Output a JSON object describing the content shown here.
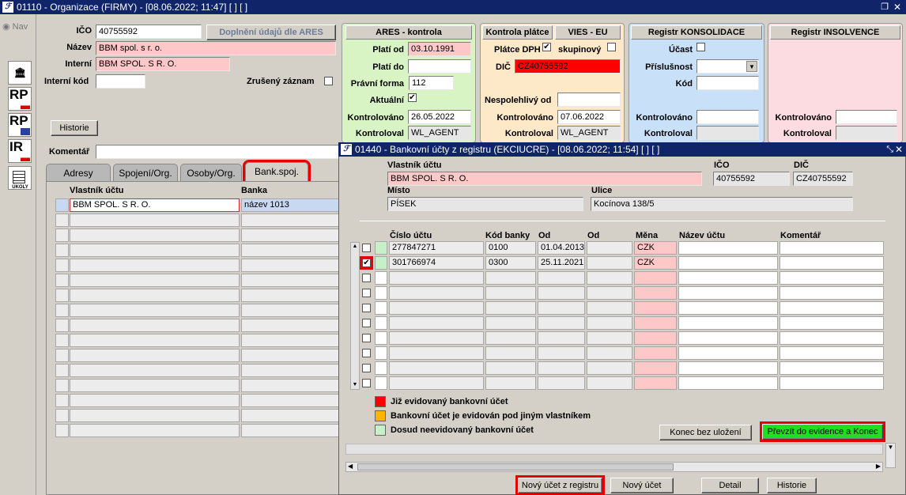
{
  "window": {
    "title": "01110 - Organizace (FIRMY) - [08.06.2022; 11:47]  [ ]  [ ]",
    "icon": "oracle-forms-icon"
  },
  "nav": {
    "label": "Nav"
  },
  "side": {
    "rp1": "RP",
    "rp2": "RP",
    "ir": "IR",
    "ukoly": "ÚKOLY"
  },
  "org": {
    "ico_label": "IČO",
    "ico": "40755592",
    "ares_btn": "Doplnění údajů dle ARES",
    "nazev_label": "Název",
    "nazev": "BBM spol. s r. o.",
    "interni_label": "Interní",
    "interni": "BBM SPOL. S R. O.",
    "interni_kod_label": "Interní kód",
    "interni_kod": "",
    "zruseny_label": "Zrušený záznam",
    "historie_btn": "Historie",
    "komentar_label": "Komentář",
    "komentar": ""
  },
  "ares": {
    "header": "ARES - kontrola",
    "plati_od_label": "Platí od",
    "plati_od": "03.10.1991",
    "plati_do_label": "Platí do",
    "plati_do": "",
    "pravni_forma_label": "Právní forma",
    "pravni_forma": "112",
    "aktualni_label": "Aktuální",
    "kontrolovano_label": "Kontrolováno",
    "kontrolovano": "26.05.2022",
    "kontroloval_label": "Kontroloval",
    "kontroloval": "WL_AGENT"
  },
  "platce": {
    "header": "Kontrola plátce",
    "vies_header": "VIES - EU",
    "platce_dph_label": "Plátce DPH",
    "skupinovy_label": "skupinový",
    "dic_label": "DIČ",
    "dic": "CZ40755592",
    "nespolehlivy_label": "Nespolehlivý od",
    "nespolehlivy": "",
    "kontrolovano_label": "Kontrolováno",
    "kontrolovano": "07.06.2022",
    "kontroloval_label": "Kontroloval",
    "kontroloval": "WL_AGENT"
  },
  "konsolidace": {
    "header": "Registr KONSOLIDACE",
    "ucast_label": "Účast",
    "prislusnost_label": "Příslušnost",
    "kod_label": "Kód",
    "kontrolovano_label": "Kontrolováno",
    "kontroloval_label": "Kontroloval"
  },
  "insolvence": {
    "header": "Registr INSOLVENCE",
    "kontrolovano_label": "Kontrolováno",
    "kontroloval_label": "Kontroloval"
  },
  "tabs": [
    {
      "label": "Adresy"
    },
    {
      "label": "Spojení/Org."
    },
    {
      "label": "Osoby/Org."
    },
    {
      "label": "Bank.spoj."
    }
  ],
  "bank": {
    "col_vlastnik": "Vlastník účtu",
    "col_banka": "Banka",
    "rows": [
      {
        "vlastnik": "BBM SPOL. S R. O.",
        "banka": "název 1013"
      }
    ]
  },
  "dialog": {
    "title": "01440 - Bankovní účty z registru (EKCIUCRE) - [08.06.2022; 11:54]  [ ]  [ ]",
    "vlastnik_label": "Vlastník účtu",
    "vlastnik": "BBM SPOL. S R. O.",
    "ico_label": "IČO",
    "ico": "40755592",
    "dic_label": "DIČ",
    "dic": "CZ40755592",
    "misto_label": "Místo",
    "misto": "PÍSEK",
    "ulice_label": "Ulice",
    "ulice": "Kocínova 138/5",
    "cols": {
      "cislo": "Číslo účtu",
      "kod": "Kód banky",
      "od": "Od",
      "od2": "Od",
      "mena": "Měna",
      "nazev": "Název účtu",
      "komentar": "Komentář"
    },
    "rows": [
      {
        "cislo": "277847271",
        "kod": "0100",
        "od": "01.04.2013",
        "mena": "CZK",
        "checked": false
      },
      {
        "cislo": "301766974",
        "kod": "0300",
        "od": "25.11.2021",
        "mena": "CZK",
        "checked": true
      }
    ],
    "legend": [
      {
        "color": "#ff0000",
        "text": "Již evidovaný bankovní účet"
      },
      {
        "color": "#ffb400",
        "text": "Bankovní účet je evidován pod jiným vlastníkem"
      },
      {
        "color": "#c8f0c8",
        "text": "Dosud neevidovaný bankovní účet"
      }
    ],
    "konec_btn": "Konec bez uložení",
    "prevzit_btn": "Převzít do evidence a Konec"
  },
  "bottom": {
    "novy_registr": "Nový účet z registru",
    "novy": "Nový účet",
    "detail": "Detail",
    "historie": "Historie"
  }
}
